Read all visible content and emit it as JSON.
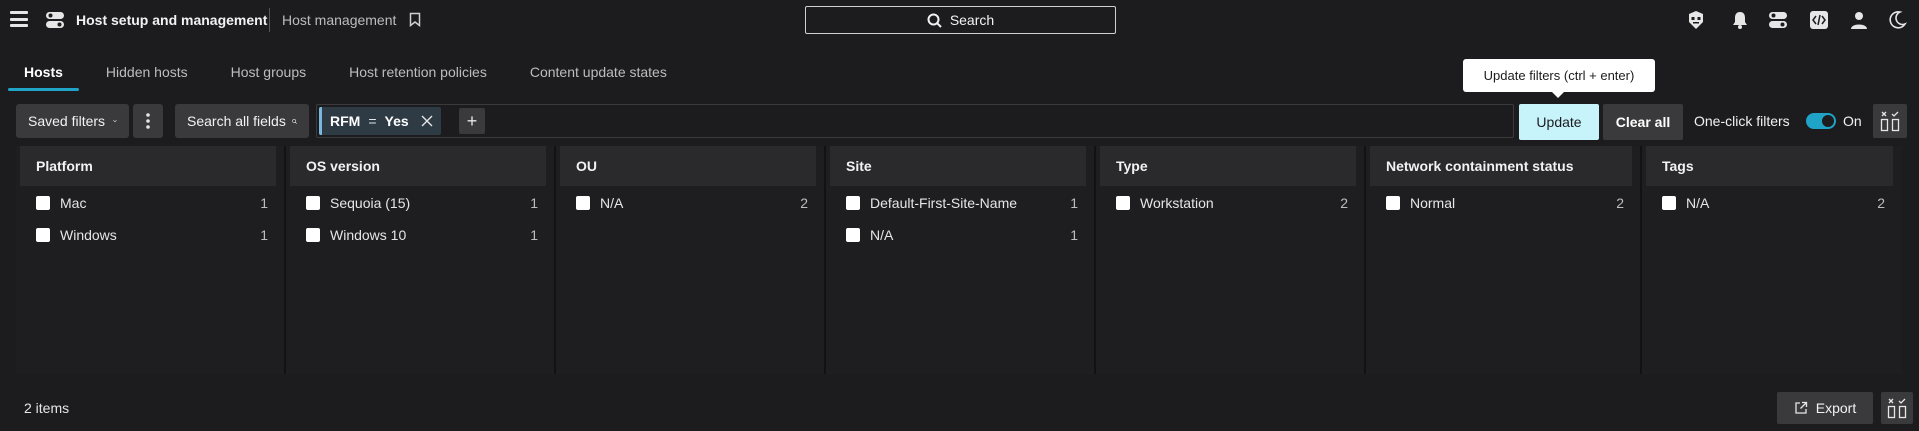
{
  "header": {
    "app_title": "Host setup and management",
    "sub_title": "Host management",
    "search_label": "Search"
  },
  "tabs": [
    {
      "label": "Hosts",
      "active": true
    },
    {
      "label": "Hidden hosts",
      "active": false
    },
    {
      "label": "Host groups",
      "active": false
    },
    {
      "label": "Host retention policies",
      "active": false
    },
    {
      "label": "Content update states",
      "active": false
    }
  ],
  "tooltip": "Update filters (ctrl + enter)",
  "filterbar": {
    "saved_filters": "Saved filters",
    "search_all_fields": "Search all fields",
    "chip": {
      "field": "RFM",
      "operator": "=",
      "value": "Yes"
    },
    "add": "+",
    "update": "Update",
    "clear_all": "Clear all",
    "one_click_filters": "One-click filters",
    "toggle_state": "On"
  },
  "panels": [
    {
      "title": "Platform",
      "rows": [
        {
          "label": "Mac",
          "count": "1"
        },
        {
          "label": "Windows",
          "count": "1"
        }
      ]
    },
    {
      "title": "OS version",
      "rows": [
        {
          "label": "Sequoia (15)",
          "count": "1"
        },
        {
          "label": "Windows 10",
          "count": "1"
        }
      ]
    },
    {
      "title": "OU",
      "rows": [
        {
          "label": "N/A",
          "count": "2"
        }
      ]
    },
    {
      "title": "Site",
      "rows": [
        {
          "label": "Default-First-Site-Name",
          "count": "1"
        },
        {
          "label": "N/A",
          "count": "1"
        }
      ]
    },
    {
      "title": "Type",
      "rows": [
        {
          "label": "Workstation",
          "count": "2"
        }
      ]
    },
    {
      "title": "Network containment status",
      "rows": [
        {
          "label": "Normal",
          "count": "2"
        }
      ]
    },
    {
      "title": "Tags",
      "rows": [
        {
          "label": "N/A",
          "count": "2"
        }
      ]
    }
  ],
  "footer": {
    "items_count": "2 items",
    "export": "Export"
  },
  "colors": {
    "accent": "#1fa3c7",
    "update_bg": "#c7f3fb",
    "background": "#1c1c1e"
  }
}
